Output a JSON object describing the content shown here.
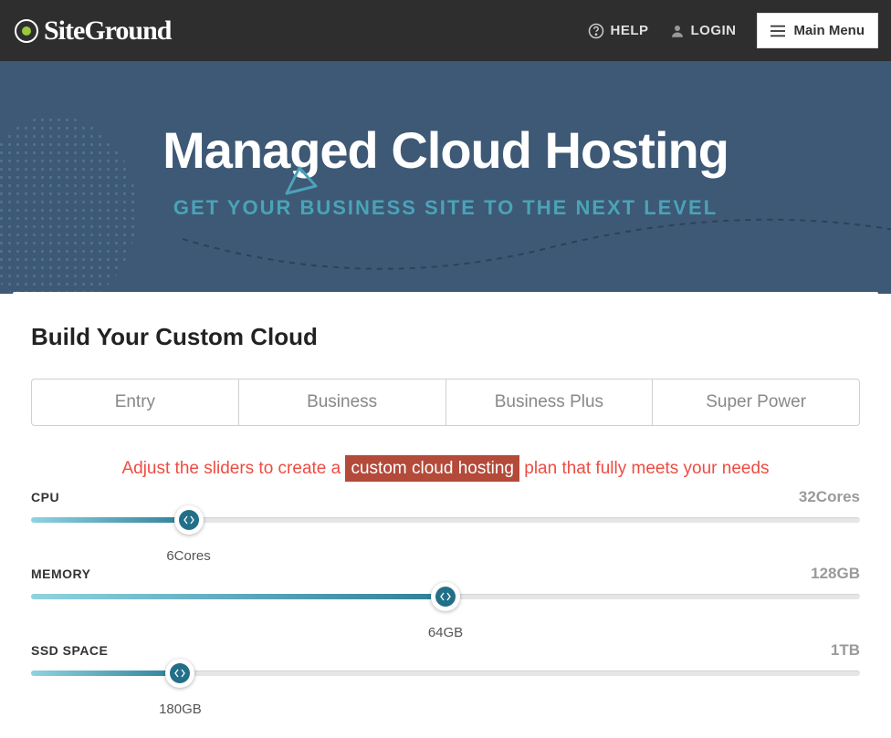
{
  "header": {
    "logo_text": "SiteGround",
    "help": "HELP",
    "login": "LOGIN",
    "menu": "Main Menu"
  },
  "hero": {
    "title": "Managed Cloud Hosting",
    "subtitle": "GET YOUR BUSINESS SITE TO THE NEXT LEVEL"
  },
  "card": {
    "title": "Build Your Custom Cloud",
    "tabs": [
      "Entry",
      "Business",
      "Business Plus",
      "Super Power"
    ],
    "instruction_pre": "Adjust the sliders to create a ",
    "instruction_hl": "custom cloud hosting",
    "instruction_post": " plan that fully meets your needs",
    "sliders": [
      {
        "name": "CPU",
        "current": "6Cores",
        "max": "32Cores",
        "percent": 19
      },
      {
        "name": "MEMORY",
        "current": "64GB",
        "max": "128GB",
        "percent": 50
      },
      {
        "name": "SSD SPACE",
        "current": "180GB",
        "max": "1TB",
        "percent": 18
      }
    ]
  }
}
